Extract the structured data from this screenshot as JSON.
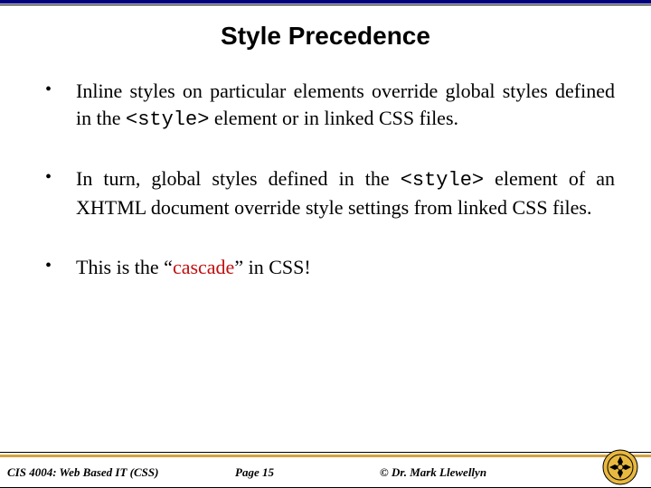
{
  "title": "Style Precedence",
  "bullets": [
    {
      "pre1": "Inline styles on particular elements override global styles defined in the ",
      "code1": "<style>",
      "post1": " element or in linked CSS files."
    },
    {
      "pre1": "In turn, global styles defined in the ",
      "code1": "<style>",
      "post1": " element of an XHTML document override style settings from linked CSS files."
    },
    {
      "pre1": "This is the “",
      "highlight": "cascade",
      "post1": "” in CSS!"
    }
  ],
  "footer": {
    "left": "CIS 4004: Web Based IT (CSS)",
    "center": "Page 15",
    "right": "© Dr. Mark Llewellyn"
  }
}
